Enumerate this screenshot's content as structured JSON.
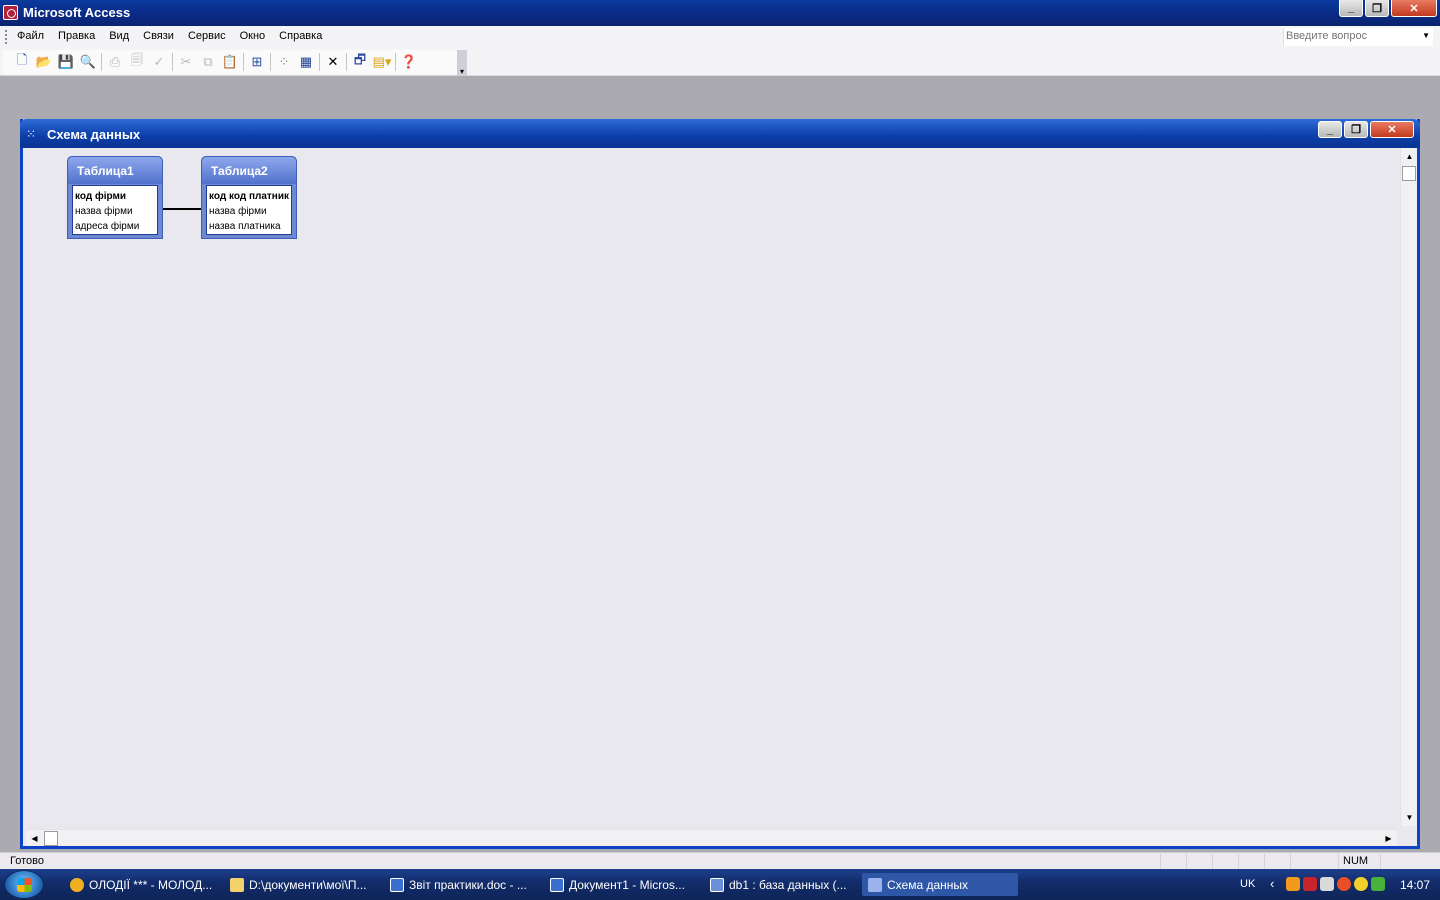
{
  "app": {
    "title": "Microsoft Access"
  },
  "menu": {
    "items": [
      {
        "label": "Файл"
      },
      {
        "label": "Правка"
      },
      {
        "label": "Вид"
      },
      {
        "label": "Связи"
      },
      {
        "label": "Сервис"
      },
      {
        "label": "Окно"
      },
      {
        "label": "Справка"
      }
    ],
    "ask_placeholder": "Введите вопрос"
  },
  "toolbar": {
    "icons": [
      "new-icon",
      "open-icon",
      "save-icon",
      "find-icon",
      "print-icon",
      "preview-icon",
      "spelling-icon",
      "cut-icon",
      "copy-icon",
      "paste-icon",
      "show-table-icon",
      "direct-relationships-icon",
      "all-relationships-icon",
      "delete-icon",
      "database-window-icon",
      "new-object-icon",
      "help-icon"
    ]
  },
  "child_window": {
    "title": "Схема данных"
  },
  "tables": [
    {
      "name": "Таблица1",
      "fields": [
        {
          "label": "код фірми",
          "key": true
        },
        {
          "label": "назва фірми",
          "key": false
        },
        {
          "label": "адреса фірми",
          "key": false
        }
      ]
    },
    {
      "name": "Таблица2",
      "fields": [
        {
          "label": "код код платник",
          "key": true
        },
        {
          "label": "назва фірми",
          "key": false
        },
        {
          "label": "назва платника",
          "key": false
        }
      ]
    }
  ],
  "status": {
    "text": "Готово",
    "num": "NUM"
  },
  "taskbar": {
    "tasks": [
      {
        "label": "ОЛОДІЇ *** - МОЛОД...",
        "color": "#f0b020"
      },
      {
        "label": "D:\\документи\\мої\\П...",
        "color": "#f2d36b"
      },
      {
        "label": "Звіт практики.doc - ...",
        "color": "#3a6fd0"
      },
      {
        "label": "Документ1 - Micros...",
        "color": "#3a6fd0"
      },
      {
        "label": "db1 : база данных (...",
        "color": "#6b8fd8"
      },
      {
        "label": "Схема данных",
        "color": "#9cb4ee"
      }
    ],
    "lang": "UK",
    "clock": "14:07"
  }
}
